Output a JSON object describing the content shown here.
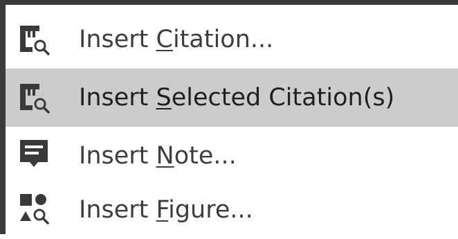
{
  "menu": {
    "items": [
      {
        "icon": "citation-search-icon",
        "text_before": "Insert ",
        "mnemonic": "C",
        "text_after": "itation...",
        "selected": false
      },
      {
        "icon": "citation-search-icon",
        "text_before": "Insert ",
        "mnemonic": "S",
        "text_after": "elected Citation(s)",
        "selected": true
      },
      {
        "icon": "note-icon",
        "text_before": "Insert ",
        "mnemonic": "N",
        "text_after": "ote...",
        "selected": false
      },
      {
        "icon": "figure-search-icon",
        "text_before": "Insert ",
        "mnemonic": "F",
        "text_after": "igure...",
        "selected": false
      }
    ]
  },
  "colors": {
    "highlight": "#cccccc",
    "text": "#3d3d3d",
    "icon": "#3a3a3a",
    "border": "#3a3a3a"
  }
}
